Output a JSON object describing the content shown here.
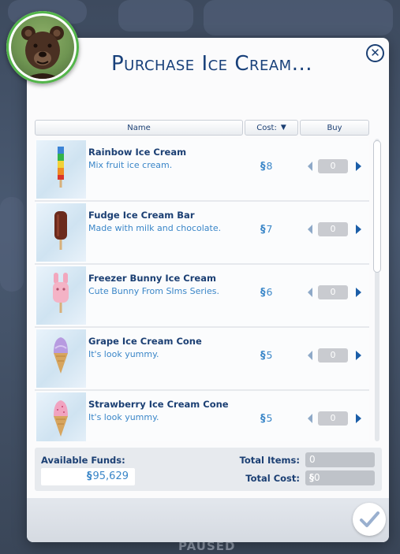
{
  "dialog": {
    "title": "Purchase Ice Cream...",
    "close_icon": "close-icon"
  },
  "columns": {
    "name": "Name",
    "cost": "Cost:",
    "buy": "Buy"
  },
  "items": [
    {
      "name": "Rainbow Ice Cream",
      "description": "Mix fruit ice cream.",
      "currency": "§",
      "price": "8",
      "qty": "0",
      "icon": "rainbow-popsicle-icon"
    },
    {
      "name": "Fudge Ice Cream Bar",
      "description": "Made with milk and chocolate.",
      "currency": "§",
      "price": "7",
      "qty": "0",
      "icon": "fudge-bar-icon"
    },
    {
      "name": "Freezer Bunny Ice Cream",
      "description": "Cute Bunny From SIms Series.",
      "currency": "§",
      "price": "6",
      "qty": "0",
      "icon": "bunny-popsicle-icon"
    },
    {
      "name": "Grape Ice Cream Cone",
      "description": "It's look yummy.",
      "currency": "§",
      "price": "5",
      "qty": "0",
      "icon": "grape-cone-icon"
    },
    {
      "name": "Strawberry Ice Cream Cone",
      "description": "It's look yummy.",
      "currency": "§",
      "price": "5",
      "qty": "0",
      "icon": "strawberry-cone-icon"
    }
  ],
  "footer": {
    "funds_label": "Available Funds:",
    "funds_currency": "§",
    "funds_value": "95,629",
    "total_items_label": "Total Items:",
    "total_items_value": "0",
    "total_cost_label": "Total Cost:",
    "total_cost_currency": "§",
    "total_cost_value": "0"
  },
  "background": {
    "paused_text": "PAUSED"
  },
  "colors": {
    "accent": "#18407a",
    "link_blue": "#3a86c8",
    "avatar_ring": "#53b54a"
  }
}
